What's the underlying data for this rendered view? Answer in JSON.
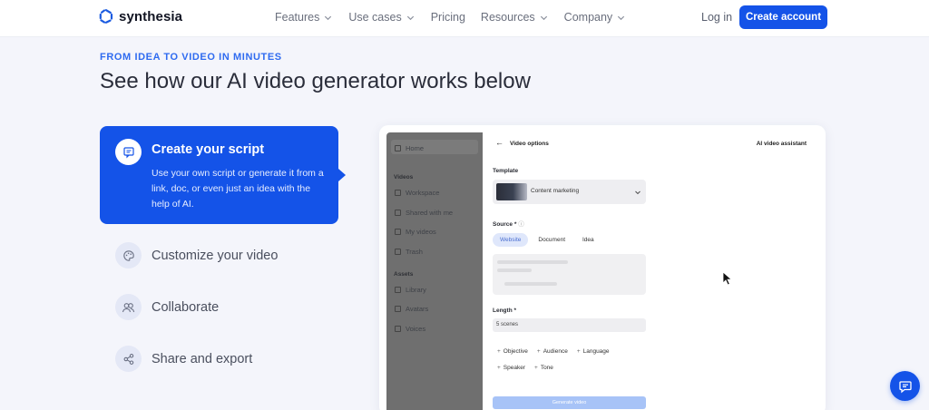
{
  "nav": {
    "brand": "synthesia",
    "links": [
      {
        "label": "Features",
        "dropdown": true
      },
      {
        "label": "Use cases",
        "dropdown": true
      },
      {
        "label": "Pricing",
        "dropdown": false
      },
      {
        "label": "Resources",
        "dropdown": true
      },
      {
        "label": "Company",
        "dropdown": true
      }
    ],
    "login": "Log in",
    "cta": "Create account"
  },
  "hero": {
    "eyebrow": "FROM IDEA TO VIDEO IN MINUTES",
    "headline": "See how our AI video generator works below"
  },
  "steps": [
    {
      "title": "Create your script",
      "description": "Use your own script or generate it from a link, doc, or even just an idea with the help of AI.",
      "icon": "script-icon",
      "active": true
    },
    {
      "title": "Customize your video",
      "icon": "palette-icon",
      "active": false
    },
    {
      "title": "Collaborate",
      "icon": "users-icon",
      "active": false
    },
    {
      "title": "Share and export",
      "icon": "share-icon",
      "active": false
    }
  ],
  "mockup": {
    "sidebar": {
      "home": "Home",
      "videos_heading": "Videos",
      "videos_items": [
        "Workspace",
        "Shared with me",
        "My videos",
        "Trash"
      ],
      "assets_heading": "Assets",
      "assets_items": [
        "Library",
        "Avatars",
        "Voices"
      ]
    },
    "header_title": "Video options",
    "assistant_title": "AI video assistant",
    "template_label": "Template",
    "template_value": "Content marketing",
    "source_label": "Source *",
    "source_tabs": [
      "Website",
      "Document",
      "Idea"
    ],
    "length_label": "Length *",
    "length_value": "5 scenes",
    "options_row1": [
      "Objective",
      "Audience",
      "Language"
    ],
    "options_row2": [
      "Speaker",
      "Tone"
    ],
    "generate_label": "Generate video"
  },
  "colors": {
    "brand": "#1453e8",
    "eyebrow": "#2f6bf0",
    "background": "#f4f5fb"
  }
}
